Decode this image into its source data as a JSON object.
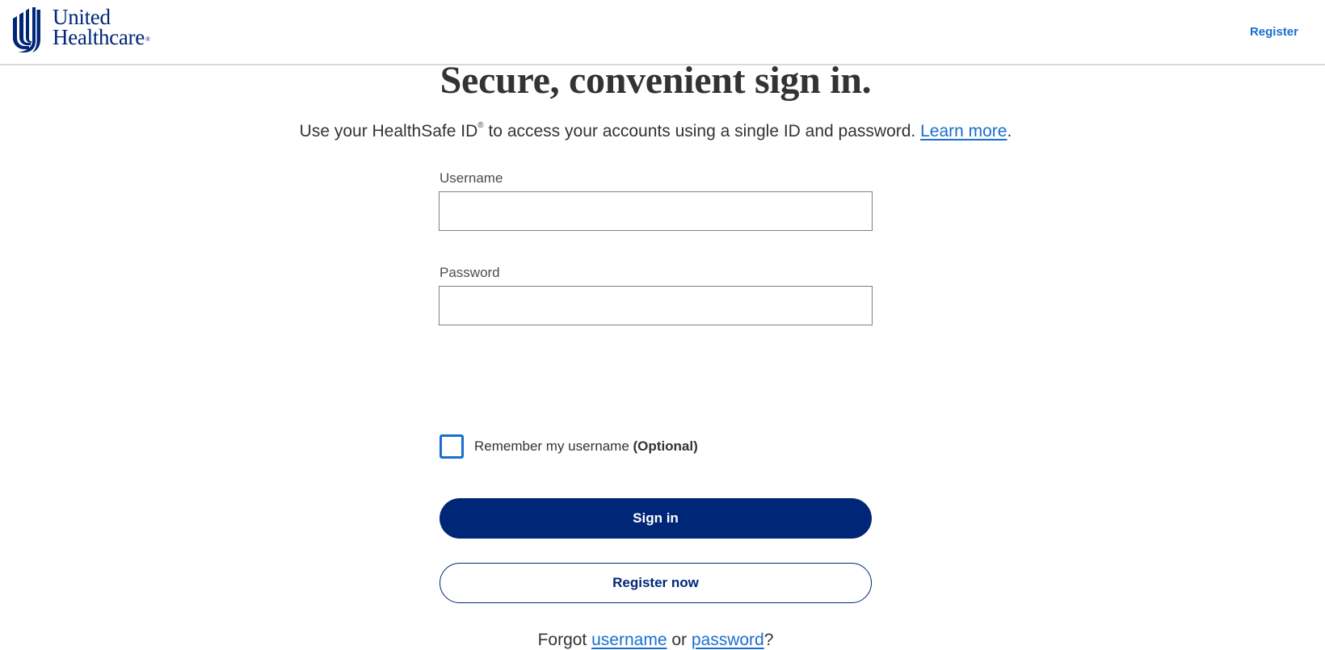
{
  "header": {
    "logo_line1": "United",
    "logo_line2": "Healthcare",
    "logo_reg": "®",
    "register_link": "Register"
  },
  "main": {
    "title": "Secure, convenient sign in.",
    "subtitle_pre": "Use your HealthSafe ID",
    "subtitle_reg": "®",
    "subtitle_post": " to access your accounts using a single ID and password. ",
    "learn_more": "Learn more",
    "subtitle_end": "."
  },
  "form": {
    "username_label": "Username",
    "username_value": "",
    "password_label": "Password",
    "password_value": "",
    "remember_label": "Remember my username ",
    "remember_optional": "(Optional)",
    "remember_checked": false,
    "sign_in": "Sign in",
    "register_now": "Register now",
    "forgot_pre": "Forgot ",
    "forgot_username": "username",
    "forgot_or": " or ",
    "forgot_password": "password",
    "forgot_end": "?"
  },
  "colors": {
    "brand_navy": "#002677",
    "link_blue": "#196ecf",
    "text": "#333333"
  },
  "icons": {
    "logo": "uhc-u-logo-icon"
  }
}
